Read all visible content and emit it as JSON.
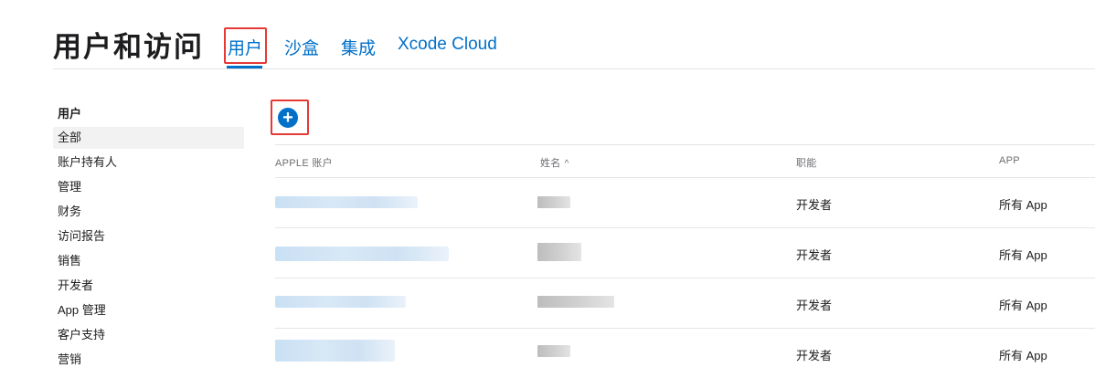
{
  "header": {
    "title": "用户和访问",
    "tabs": [
      {
        "label": "用户",
        "active": true
      },
      {
        "label": "沙盒",
        "active": false
      },
      {
        "label": "集成",
        "active": false
      },
      {
        "label": "Xcode Cloud",
        "active": false
      }
    ]
  },
  "sidebar": {
    "heading": "用户",
    "items": [
      {
        "label": "全部",
        "selected": true
      },
      {
        "label": "账户持有人"
      },
      {
        "label": "管理"
      },
      {
        "label": "财务"
      },
      {
        "label": "访问报告"
      },
      {
        "label": "销售"
      },
      {
        "label": "开发者"
      },
      {
        "label": "App 管理"
      },
      {
        "label": "客户支持"
      },
      {
        "label": "营销"
      }
    ]
  },
  "toolbar": {
    "add_icon": "plus-circle-icon",
    "add_glyph": "+"
  },
  "table": {
    "columns": [
      "APPLE 账户",
      "姓名",
      "职能",
      "APP"
    ],
    "sort_indicator": "^",
    "rows": [
      {
        "role": "开发者",
        "apps": "所有 App"
      },
      {
        "role": "开发者",
        "apps": "所有 App"
      },
      {
        "role": "开发者",
        "apps": "所有 App"
      },
      {
        "role": "开发者",
        "apps": "所有 App"
      }
    ]
  },
  "colors": {
    "accent": "#0070c9",
    "highlight": "#e53935",
    "selected_bg": "#f2f2f2"
  }
}
